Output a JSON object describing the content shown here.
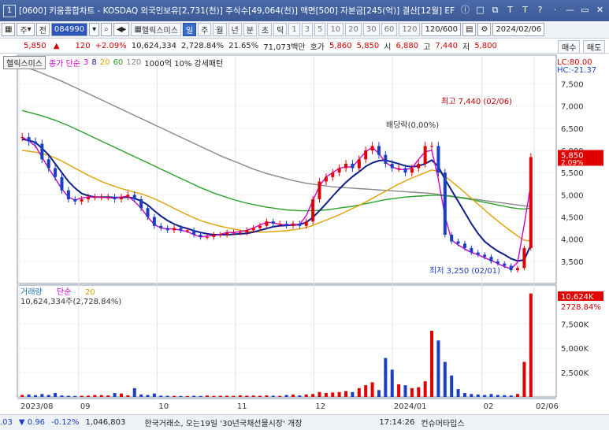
{
  "window": {
    "app_number": "1",
    "title": "[0600] 키움종합차트 - KOSDAQ 외국인보유[2,731(천)] 주식수[49,064(천)] 액면[500] 자본금[245(억)] 결산[12월] EF",
    "buttons": [
      "ⓘ",
      "□",
      "⧉",
      "T",
      "T",
      "?",
      "·",
      "—",
      "▭",
      "✕"
    ]
  },
  "toolbar": {
    "market": "주",
    "prev_label": "전",
    "code": "084990",
    "stock_name": "헬릭스미스",
    "period_buttons": [
      "일",
      "주",
      "월",
      "년",
      "분",
      "초",
      "틱"
    ],
    "active_period": "일",
    "interval_buttons": [
      "1",
      "3",
      "5",
      "10",
      "20",
      "30",
      "60",
      "120"
    ],
    "count_value": "120/600",
    "date_value": "2024/02/06",
    "buy_label": "매수",
    "sell_label": "매도"
  },
  "infobar": {
    "price": "5,850",
    "change": "120",
    "change_pct": "+2.09%",
    "volume": "10,624,334",
    "volume_ratio": "2,728.84%",
    "turnover": "21.65%",
    "amount": "71,073백만",
    "ask_label": "호가",
    "ask1": "5,860",
    "ask2": "5,850",
    "open_label": "시",
    "open": "6,880",
    "high_label": "고",
    "high": "7,440",
    "low_label": "저",
    "low": "5,800"
  },
  "legend": {
    "stock_name": "헬릭스미스",
    "ma_label": "종가 단순",
    "ma_periods": [
      "3",
      "8",
      "20",
      "60",
      "120"
    ],
    "ma_colors": [
      "#cc00cc",
      "#0b1f8a",
      "#e0a000",
      "#2aa02a",
      "#888888"
    ],
    "extra": "1000억 10% 강세패턴",
    "lc": "LC:80.00",
    "hc": "HC:-21.37"
  },
  "annotations": {
    "high_note": "최고 7,440 (02/06)",
    "low_note": "최저 3,250 (02/01)",
    "dividend_note": "배당락(0,00%)",
    "current_price": "5,850",
    "current_pct": "2.09%"
  },
  "volume_panel": {
    "legend_label": "거래량",
    "legend_type": "단순",
    "legend_period": "20",
    "value_text": "10,624,334주(2,728.84%)",
    "current_label": "10,624K",
    "current_pct": "2728.84%"
  },
  "status": {
    "index_fragment": ".03",
    "index_change": "▼ 0.96",
    "index_pct": "-0.12%",
    "index_volume": "1,046,803",
    "news": "한국거래소, 오는19일 '30년국채선물시장' 개장",
    "time": "17:14:26",
    "company": "컨슈머타입스"
  },
  "chart_data": {
    "type": "candlestick",
    "price_axis_ticks": [
      3500,
      4000,
      4500,
      5000,
      5500,
      6000,
      6500,
      7000,
      7500
    ],
    "price_range": [
      3000,
      7900
    ],
    "x_ticks": [
      "2023/08",
      "09",
      "10",
      "11",
      "12",
      "2024/01",
      "02",
      "02/06"
    ],
    "volume_axis_ticks": [
      "2,500K",
      "5,000K",
      "7,500K"
    ],
    "volume_range": [
      0,
      11000
    ],
    "volume_unit": "K",
    "closes": [
      6300,
      6200,
      6150,
      5800,
      5600,
      5400,
      5100,
      4900,
      4850,
      4900,
      4950,
      4950,
      4950,
      4950,
      4900,
      4950,
      5000,
      4900,
      4700,
      4500,
      4300,
      4250,
      4200,
      4250,
      4200,
      4200,
      4100,
      4050,
      4050,
      4100,
      4100,
      4150,
      4150,
      4150,
      4200,
      4250,
      4300,
      4400,
      4350,
      4350,
      4300,
      4350,
      4300,
      4400,
      4900,
      5300,
      5400,
      5500,
      5600,
      5700,
      5600,
      5800,
      6000,
      6100,
      5900,
      5700,
      5600,
      5600,
      5500,
      5600,
      5700,
      6100,
      6100,
      5500,
      4100,
      3950,
      3900,
      3800,
      3700,
      3650,
      3600,
      3500,
      3450,
      3400,
      3300,
      3350,
      3800,
      5850
    ],
    "volumes": [
      200,
      250,
      180,
      300,
      200,
      400,
      150,
      120,
      100,
      120,
      130,
      200,
      180,
      150,
      400,
      350,
      160,
      900,
      250,
      200,
      350,
      130,
      120,
      110,
      100,
      90,
      120,
      100,
      140,
      100,
      120,
      130,
      110,
      160,
      130,
      140,
      120,
      150,
      130,
      110,
      200,
      230,
      150,
      250,
      300,
      500,
      400,
      450,
      500,
      600,
      500,
      900,
      1200,
      1500,
      700,
      4000,
      2800,
      1300,
      1200,
      900,
      1000,
      1600,
      6800,
      5800,
      3600,
      2200,
      800,
      400,
      300,
      250,
      200,
      300,
      200,
      180,
      150,
      300,
      3600,
      10624
    ],
    "series": [
      {
        "name": "3",
        "values": [
          6300,
          6217,
          6100,
          5850,
          5600,
          5370,
          5130,
          4950,
          4880,
          4930,
          4950,
          4950,
          4950,
          4930,
          4930,
          4950,
          4970,
          4850,
          4700,
          4500,
          4330,
          4250,
          4230,
          4230,
          4200,
          4170,
          4100,
          4050,
          4070,
          4080,
          4110,
          4150,
          4150,
          4170,
          4200,
          4250,
          4320,
          4380,
          4370,
          4330,
          4320,
          4330,
          4330,
          4530,
          4870,
          5200,
          5400,
          5500,
          5600,
          5630,
          5630,
          5800,
          5970,
          6070,
          5930,
          5730,
          5630,
          5570,
          5570,
          5600,
          5800,
          5970,
          6000,
          5350,
          4520,
          3980,
          3870,
          3780,
          3700,
          3650,
          3580,
          3520,
          3450,
          3380,
          3330,
          3480,
          4330,
          5240
        ]
      },
      {
        "name": "8",
        "values": [
          6250,
          6230,
          6180,
          6050,
          5900,
          5700,
          5500,
          5300,
          5150,
          5030,
          4980,
          4950,
          4950,
          4950,
          4940,
          4940,
          4950,
          4920,
          4860,
          4770,
          4640,
          4520,
          4420,
          4340,
          4280,
          4240,
          4190,
          4150,
          4120,
          4100,
          4100,
          4100,
          4110,
          4120,
          4130,
          4160,
          4200,
          4240,
          4280,
          4300,
          4310,
          4320,
          4330,
          4380,
          4490,
          4640,
          4800,
          4970,
          5130,
          5280,
          5410,
          5520,
          5640,
          5720,
          5770,
          5780,
          5740,
          5700,
          5650,
          5630,
          5650,
          5700,
          5780,
          5640,
          5350,
          5100,
          4850,
          4600,
          4350,
          4130,
          3950,
          3830,
          3730,
          3650,
          3560,
          3510,
          3530,
          3870
        ]
      },
      {
        "name": "20",
        "values": [
          6000,
          5980,
          5960,
          5930,
          5890,
          5830,
          5760,
          5680,
          5600,
          5520,
          5440,
          5370,
          5300,
          5240,
          5190,
          5140,
          5100,
          5060,
          5020,
          4970,
          4910,
          4840,
          4770,
          4690,
          4620,
          4550,
          4480,
          4420,
          4370,
          4330,
          4290,
          4260,
          4230,
          4200,
          4180,
          4170,
          4160,
          4160,
          4170,
          4180,
          4190,
          4210,
          4230,
          4260,
          4310,
          4370,
          4430,
          4490,
          4550,
          4620,
          4690,
          4760,
          4840,
          4920,
          5000,
          5080,
          5160,
          5240,
          5310,
          5380,
          5440,
          5500,
          5560,
          5530,
          5420,
          5300,
          5180,
          5050,
          4920,
          4790,
          4660,
          4530,
          4410,
          4290,
          4180,
          4070,
          3980,
          3950
        ]
      },
      {
        "name": "60",
        "values": [
          6900,
          6860,
          6820,
          6780,
          6730,
          6680,
          6620,
          6560,
          6490,
          6420,
          6350,
          6280,
          6210,
          6140,
          6070,
          6000,
          5930,
          5860,
          5790,
          5720,
          5650,
          5580,
          5510,
          5440,
          5370,
          5300,
          5230,
          5160,
          5100,
          5040,
          4990,
          4940,
          4890,
          4850,
          4810,
          4780,
          4750,
          4720,
          4700,
          4680,
          4660,
          4650,
          4640,
          4640,
          4640,
          4650,
          4660,
          4680,
          4700,
          4720,
          4740,
          4770,
          4800,
          4830,
          4860,
          4890,
          4910,
          4930,
          4950,
          4960,
          4970,
          4980,
          4990,
          4990,
          4980,
          4960,
          4940,
          4920,
          4890,
          4860,
          4830,
          4800,
          4770,
          4740,
          4710,
          4690,
          4680,
          4700
        ]
      },
      {
        "name": "120",
        "values": [
          7900,
          7850,
          7800,
          7740,
          7680,
          7620,
          7560,
          7490,
          7420,
          7350,
          7280,
          7210,
          7140,
          7070,
          7000,
          6930,
          6860,
          6790,
          6720,
          6650,
          6580,
          6510,
          6440,
          6370,
          6300,
          6230,
          6160,
          6090,
          6020,
          5950,
          5880,
          5820,
          5760,
          5700,
          5640,
          5580,
          5530,
          5480,
          5440,
          5400,
          5360,
          5320,
          5290,
          5260,
          5240,
          5220,
          5200,
          5180,
          5170,
          5160,
          5150,
          5140,
          5130,
          5120,
          5110,
          5100,
          5090,
          5080,
          5070,
          5060,
          5050,
          5040,
          5030,
          5010,
          4990,
          4970,
          4950,
          4930,
          4910,
          4890,
          4870,
          4850,
          4830,
          4810,
          4790,
          4770,
          4750,
          4740
        ]
      }
    ]
  }
}
